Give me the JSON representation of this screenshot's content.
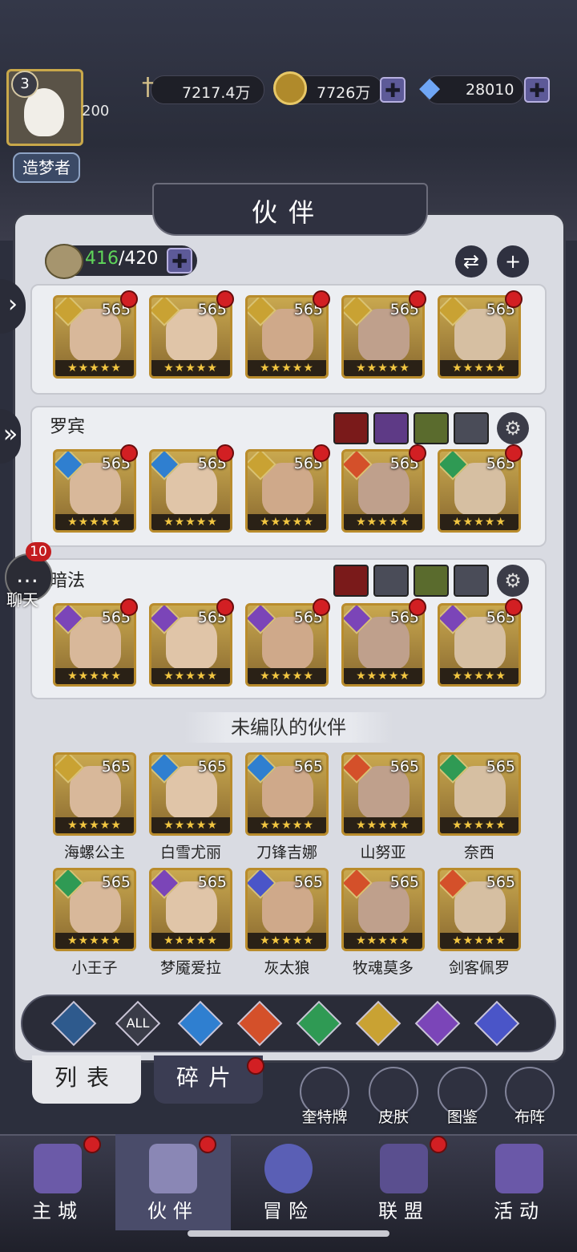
{
  "player": {
    "level": "3",
    "rank": "造梦者",
    "exp_text": "200"
  },
  "resources": [
    {
      "name": "sword-icon",
      "value": "7217.4万"
    },
    {
      "name": "gold-coin-icon",
      "value": "7726万"
    },
    {
      "name": "diamond-icon",
      "value": "28010"
    }
  ],
  "page_title": "伙伴",
  "partner_count": {
    "current": "416",
    "max": "/420"
  },
  "teams": [
    {
      "name": "",
      "heroes": [
        {
          "level": "565",
          "element": "light",
          "stars": "★★★★★"
        },
        {
          "level": "565",
          "element": "light",
          "stars": "★★★★★"
        },
        {
          "level": "565",
          "element": "light",
          "stars": "★★★★★"
        },
        {
          "level": "565",
          "element": "light",
          "stars": "★★★★★"
        },
        {
          "level": "565",
          "element": "light",
          "stars": "★★★★★"
        }
      ]
    },
    {
      "name": "罗宾",
      "heroes": [
        {
          "level": "565",
          "element": "water",
          "stars": "★★★★★"
        },
        {
          "level": "565",
          "element": "water",
          "stars": "★★★★★"
        },
        {
          "level": "565",
          "element": "light",
          "stars": "★★★★★"
        },
        {
          "level": "565",
          "element": "fire",
          "stars": "★★★★★"
        },
        {
          "level": "565",
          "element": "wind",
          "stars": "★★★★★"
        }
      ]
    },
    {
      "name": "暗法",
      "heroes": [
        {
          "level": "565",
          "element": "dark",
          "stars": "★★★★★"
        },
        {
          "level": "565",
          "element": "dark",
          "stars": "★★★★★"
        },
        {
          "level": "565",
          "element": "dark",
          "stars": "★★★★★"
        },
        {
          "level": "565",
          "element": "dark",
          "stars": "★★★★★"
        },
        {
          "level": "565",
          "element": "dark",
          "stars": "★★★★★"
        }
      ]
    }
  ],
  "unassigned_title": "未编队的伙伴",
  "unassigned": [
    {
      "name": "海螺公主",
      "level": "565",
      "element": "light",
      "stars": "★★★★★"
    },
    {
      "name": "白雪尤丽",
      "level": "565",
      "element": "water",
      "stars": "★★★★★"
    },
    {
      "name": "刀锋吉娜",
      "level": "565",
      "element": "water",
      "stars": "★★★★★"
    },
    {
      "name": "山努亚",
      "level": "565",
      "element": "fire",
      "stars": "★★★★★"
    },
    {
      "name": "奈西",
      "level": "565",
      "element": "wind",
      "stars": "★★★★★"
    },
    {
      "name": "小王子",
      "level": "565",
      "element": "wind",
      "stars": "★★★★★"
    },
    {
      "name": "梦魇爱拉",
      "level": "565",
      "element": "dark",
      "stars": "★★★★★"
    },
    {
      "name": "灰太狼",
      "level": "565",
      "element": "space",
      "stars": "★★★★★"
    },
    {
      "name": "牧魂莫多",
      "level": "565",
      "element": "fire",
      "stars": "★★★★★"
    },
    {
      "name": "剑客佩罗",
      "level": "565",
      "element": "fire",
      "stars": "★★★★★"
    }
  ],
  "filters": [
    "all-elements-icon",
    "ALL",
    "water-icon",
    "fire-icon",
    "wind-icon",
    "light-icon",
    "dark-icon",
    "space-icon"
  ],
  "filter_all_label": "ALL",
  "tabs": {
    "list": "列表",
    "fragments": "碎片"
  },
  "tools": [
    "奎特牌",
    "皮肤",
    "图鉴",
    "布阵"
  ],
  "chat": {
    "badge": "10",
    "label": "聊天"
  },
  "nav": [
    "主城",
    "伙伴",
    "冒险",
    "联盟",
    "活动"
  ],
  "colors": {
    "water": "#2f7fd0",
    "fire": "#d4502a",
    "wind": "#2f9a54",
    "light": "#c9a233",
    "dark": "#7b45b8",
    "space": "#4a55c8"
  }
}
